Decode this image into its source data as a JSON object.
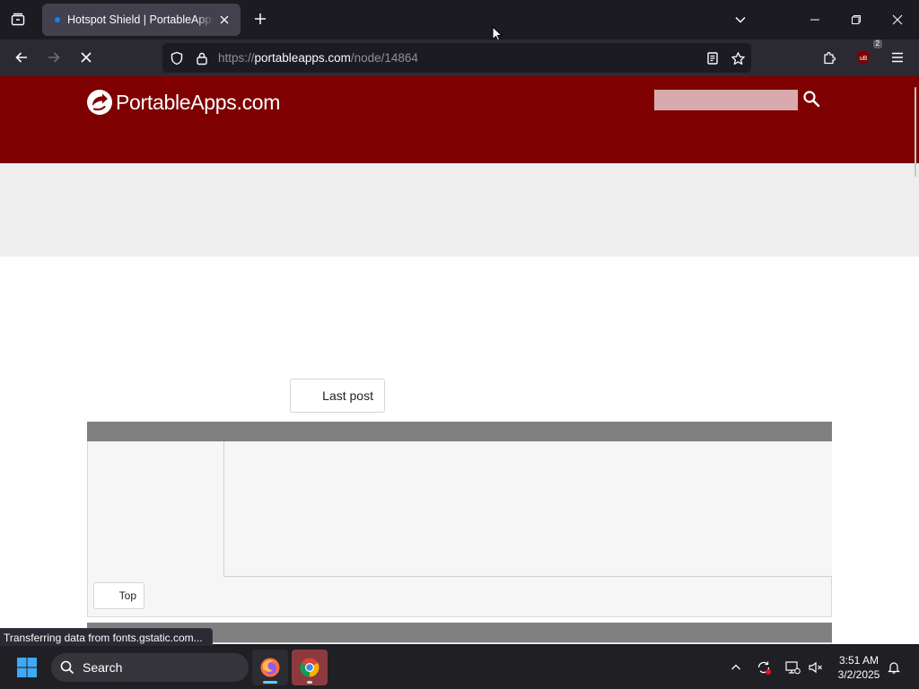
{
  "browser": {
    "tab": {
      "title": "Hotspot Shield | PortableApps.com"
    },
    "url": {
      "prefix": "https://",
      "host": "portableapps.com",
      "path": "/node/14864"
    },
    "extension_badge": "2",
    "status_text": "Transferring data from fonts.gstatic.com..."
  },
  "site": {
    "logo_text": "PortableApps.com",
    "search": {
      "value": "",
      "placeholder": ""
    }
  },
  "content": {
    "last_post_label": "Last post",
    "top_label": "Top"
  },
  "taskbar": {
    "search_label": "Search",
    "apps": [
      "firefox-icon",
      "chrome-icon"
    ],
    "clock": {
      "time": "3:51 AM",
      "date": "3/2/2025"
    }
  },
  "colors": {
    "site_header": "#7e0000",
    "chrome_dark": "#1c1b22",
    "toolbar": "#2b2a33",
    "accent": "#0a84ff"
  }
}
